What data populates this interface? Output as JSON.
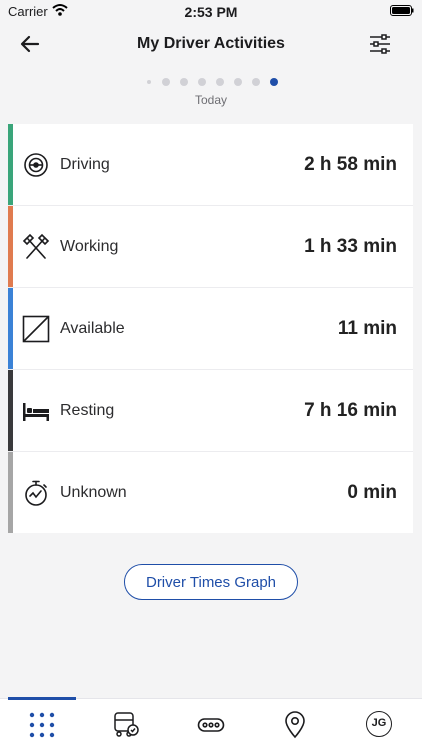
{
  "status_bar": {
    "carrier": "Carrier",
    "time": "2:53 PM"
  },
  "header": {
    "title": "My Driver Activities"
  },
  "pager": {
    "label": "Today"
  },
  "activities": [
    {
      "label": "Driving",
      "value": "2 h 58 min",
      "icon": "steering-wheel-icon",
      "color": "#3aa57a"
    },
    {
      "label": "Working",
      "value": "1 h 33 min",
      "icon": "crossed-hammers-icon",
      "color": "#e07b4f"
    },
    {
      "label": "Available",
      "value": "11 min",
      "icon": "available-box-icon",
      "color": "#3b82d6"
    },
    {
      "label": "Resting",
      "value": "7 h 16 min",
      "icon": "bed-icon",
      "color": "#3a3a3c"
    },
    {
      "label": "Unknown",
      "value": "0 min",
      "icon": "stopwatch-icon",
      "color": "#a6a6a6"
    }
  ],
  "graph_button": {
    "label": "Driver Times Graph"
  },
  "tabbar": {
    "items": [
      {
        "icon": "grid-dots-icon",
        "active": true
      },
      {
        "icon": "vehicle-check-icon"
      },
      {
        "icon": "messages-icon"
      },
      {
        "icon": "location-pin-icon"
      },
      {
        "icon": "avatar-icon",
        "label": "JG"
      }
    ]
  },
  "colors": {
    "accent": "#1f4ea8"
  }
}
